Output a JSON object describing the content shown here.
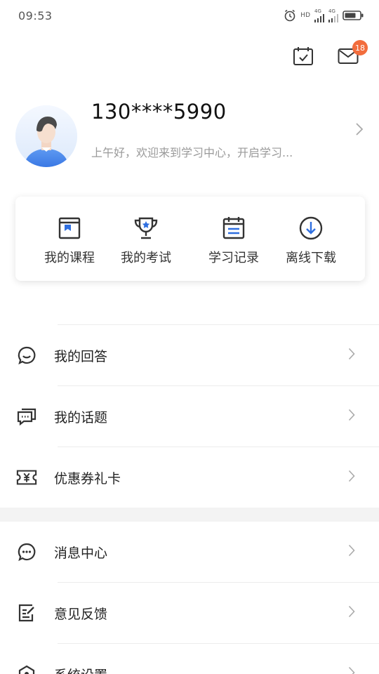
{
  "status_bar": {
    "time": "09:53",
    "hd_label": "HD",
    "net_label_1": "4G",
    "net_label_2": "4G"
  },
  "header": {
    "messages_badge": "18",
    "icons": [
      "calendar-check-icon",
      "mail-icon"
    ]
  },
  "profile": {
    "phone": "130****5990",
    "greeting": "上午好，欢迎来到学习中心，开启学习..."
  },
  "quick_actions": [
    {
      "label": "我的课程",
      "icon": "course-book-icon"
    },
    {
      "label": "我的考试",
      "icon": "trophy-icon"
    },
    {
      "label": "学习记录",
      "icon": "calendar-icon"
    },
    {
      "label": "离线下载",
      "icon": "download-icon"
    }
  ],
  "menu_group_1": [
    {
      "label": "我的回答",
      "icon": "chat-bubble-icon"
    },
    {
      "label": "我的话题",
      "icon": "topic-chat-icon"
    },
    {
      "label": "优惠券礼卡",
      "icon": "coupon-ticket-icon"
    }
  ],
  "menu_group_2": [
    {
      "label": "消息中心",
      "icon": "message-center-icon"
    },
    {
      "label": "意见反馈",
      "icon": "feedback-edit-icon"
    },
    {
      "label": "系统设置",
      "icon": "settings-icon"
    }
  ],
  "colors": {
    "accent": "#2f6fe0",
    "badge": "#f26d3d",
    "icon": "#333333",
    "muted": "#9a9a9a"
  }
}
